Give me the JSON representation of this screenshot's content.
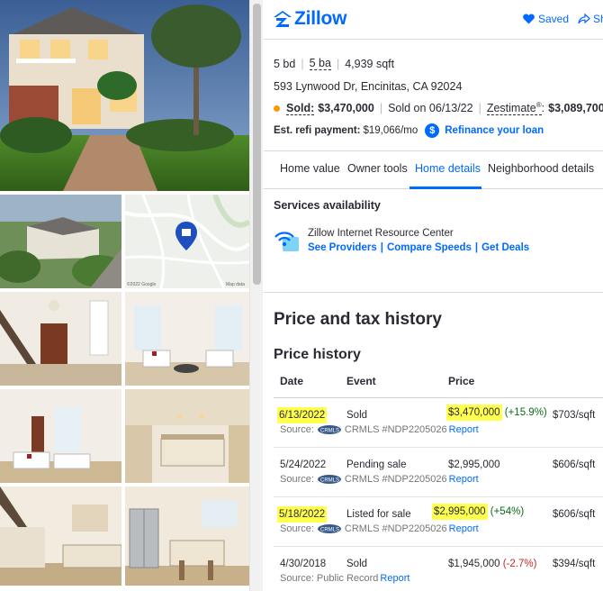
{
  "header": {
    "brand": "Zillow",
    "saved_label": "Saved",
    "share_label": "Sh"
  },
  "facts": {
    "beds": "5 bd",
    "baths": "5 ba",
    "sqft": "4,939 sqft"
  },
  "address": "593 Lynwood Dr, Encinitas, CA 92024",
  "status": {
    "sold_label": "Sold:",
    "sold_price": "$3,470,000",
    "sold_on": "Sold on 06/13/22",
    "zestimate_label": "Zestimate",
    "zestimate_mark": "®",
    "zestimate_value": "$3,089,700",
    "dot_color": "#fe9801"
  },
  "refi": {
    "label": "Est. refi payment:",
    "value": "$19,066/mo",
    "link": "Refinance your loan",
    "icon": "dollar-icon"
  },
  "tabs": [
    {
      "label": "Home value",
      "active": false
    },
    {
      "label": "Owner tools",
      "active": false
    },
    {
      "label": "Home details",
      "active": true
    },
    {
      "label": "Neighborhood details",
      "active": false
    }
  ],
  "services": {
    "title": "Services availability",
    "provider": "Zillow Internet Resource Center",
    "links": [
      "See Providers",
      "Compare Speeds",
      "Get Deals"
    ]
  },
  "price_tax": {
    "title": "Price and tax history",
    "subtitle": "Price history",
    "columns": [
      "Date",
      "Event",
      "Price"
    ],
    "rows": [
      {
        "date": "6/13/2022",
        "event": "Sold",
        "price": "$3,470,000",
        "change": "(+15.9%)",
        "per_sqft": "$703/sqft",
        "source_label": "Source:",
        "source": "CRMLS #NDP2205026",
        "report": "Report",
        "highlighted": true
      },
      {
        "date": "5/24/2022",
        "event": "Pending sale",
        "price": "$2,995,000",
        "change": "",
        "per_sqft": "$606/sqft",
        "source_label": "Source:",
        "source": "CRMLS #NDP2205026",
        "report": "Report",
        "highlighted": false
      },
      {
        "date": "5/18/2022",
        "event": "Listed for sale",
        "price": "$2,995,000",
        "change": "(+54%)",
        "per_sqft": "$606/sqft",
        "source_label": "Source:",
        "source": "CRMLS #NDP2205026",
        "report": "Report",
        "highlighted": true
      },
      {
        "date": "4/30/2018",
        "event": "Sold",
        "price": "$1,945,000",
        "change": "(-2.7%)",
        "per_sqft": "$394/sqft",
        "source_label": "Source:",
        "source": "Public Record",
        "report": "Report",
        "highlighted": false
      }
    ]
  },
  "colors": {
    "brand_blue": "#006aff",
    "highlight": "#ffff4d",
    "up": "#0a6a1a",
    "down": "#c42a2a"
  },
  "photos": {
    "map_pin_icon": "home-pin-icon",
    "map_credit": "©2022 Google",
    "map_data": "Map data"
  }
}
